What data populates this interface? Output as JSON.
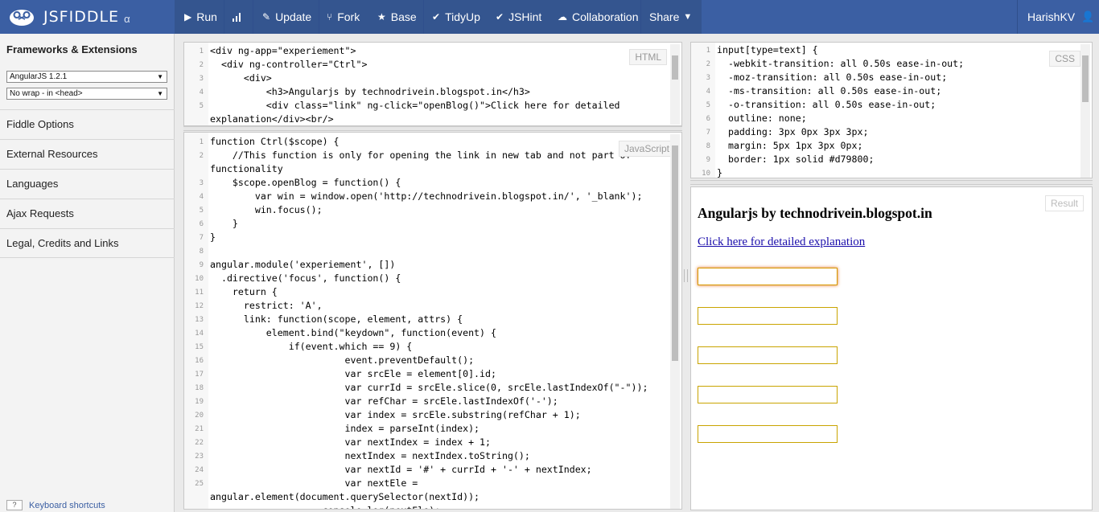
{
  "header": {
    "brand": "JSFIDDLE",
    "brand_suffix": "α",
    "run": "Run",
    "update": "Update",
    "fork": "Fork",
    "base": "Base",
    "tidyup": "TidyUp",
    "jshint": "JSHint",
    "collaboration": "Collaboration",
    "share": "Share",
    "user": "HarishKV"
  },
  "sidebar": {
    "title": "Frameworks & Extensions",
    "framework_select": "AngularJS 1.2.1",
    "wrap_select": "No wrap - in <head>",
    "items": [
      "Fiddle Options",
      "External Resources",
      "Languages",
      "Ajax Requests",
      "Legal, Credits and Links"
    ],
    "keyboard_shortcuts": "Keyboard shortcuts",
    "keyboard_key": "?"
  },
  "panes": {
    "html_label": "HTML",
    "js_label": "JavaScript",
    "css_label": "CSS",
    "result_label": "Result"
  },
  "html_code": [
    {
      "n": "1",
      "t": "<div ng-app=\"experiement\">"
    },
    {
      "n": "2",
      "t": "  <div ng-controller=\"Ctrl\">"
    },
    {
      "n": "3",
      "t": "      <div>"
    },
    {
      "n": "4",
      "t": "          <h3>Angularjs by technodrivein.blogspot.in</h3>"
    },
    {
      "n": "5",
      "t": "          <div class=\"link\" ng-click=\"openBlog()\">Click here for detailed"
    },
    {
      "n": "",
      "t": "explanation</div><br/>"
    }
  ],
  "js_code": [
    {
      "n": "1",
      "t": "function Ctrl($scope) {"
    },
    {
      "n": "2",
      "t": "    //This function is only for opening the link in new tab and not part of"
    },
    {
      "n": "",
      "t": "functionality"
    },
    {
      "n": "3",
      "t": "    $scope.openBlog = function() {"
    },
    {
      "n": "4",
      "t": "        var win = window.open('http://technodrivein.blogspot.in/', '_blank');"
    },
    {
      "n": "5",
      "t": "        win.focus();"
    },
    {
      "n": "6",
      "t": "    }"
    },
    {
      "n": "7",
      "t": "}"
    },
    {
      "n": "8",
      "t": ""
    },
    {
      "n": "9",
      "t": "angular.module('experiement', [])"
    },
    {
      "n": "10",
      "t": "  .directive('focus', function() {"
    },
    {
      "n": "11",
      "t": "    return {"
    },
    {
      "n": "12",
      "t": "      restrict: 'A',"
    },
    {
      "n": "13",
      "t": "      link: function(scope, element, attrs) {"
    },
    {
      "n": "14",
      "t": "          element.bind(\"keydown\", function(event) {"
    },
    {
      "n": "15",
      "t": "              if(event.which == 9) {"
    },
    {
      "n": "16",
      "t": "                        event.preventDefault();"
    },
    {
      "n": "17",
      "t": "                        var srcEle = element[0].id;"
    },
    {
      "n": "18",
      "t": "                        var currId = srcEle.slice(0, srcEle.lastIndexOf(\"-\"));"
    },
    {
      "n": "19",
      "t": "                        var refChar = srcEle.lastIndexOf('-');"
    },
    {
      "n": "20",
      "t": "                        var index = srcEle.substring(refChar + 1);"
    },
    {
      "n": "21",
      "t": "                        index = parseInt(index);"
    },
    {
      "n": "22",
      "t": "                        var nextIndex = index + 1;"
    },
    {
      "n": "23",
      "t": "                        nextIndex = nextIndex.toString();"
    },
    {
      "n": "24",
      "t": "                        var nextId = '#' + currId + '-' + nextIndex;"
    },
    {
      "n": "25",
      "t": "                        var nextEle ="
    },
    {
      "n": "",
      "t": "angular.element(document.querySelector(nextId));"
    },
    {
      "n": "",
      "t": "                    console.log(nextEle);"
    }
  ],
  "css_code": [
    {
      "n": "1",
      "t": "input[type=text] {"
    },
    {
      "n": "2",
      "t": "  -webkit-transition: all 0.50s ease-in-out;"
    },
    {
      "n": "3",
      "t": "  -moz-transition: all 0.50s ease-in-out;"
    },
    {
      "n": "4",
      "t": "  -ms-transition: all 0.50s ease-in-out;"
    },
    {
      "n": "5",
      "t": "  -o-transition: all 0.50s ease-in-out;"
    },
    {
      "n": "6",
      "t": "  outline: none;"
    },
    {
      "n": "7",
      "t": "  padding: 3px 0px 3px 3px;"
    },
    {
      "n": "8",
      "t": "  margin: 5px 1px 3px 0px;"
    },
    {
      "n": "9",
      "t": "  border: 1px solid #d79800;"
    },
    {
      "n": "10",
      "t": "}"
    }
  ],
  "result": {
    "heading": "Angularjs by technodrivein.blogspot.in",
    "link": "Click here for detailed explanation",
    "input_count": 5
  },
  "colors": {
    "header_bg": "#3b5fa3",
    "input_border": "#d79800",
    "link": "#1a0dab"
  }
}
